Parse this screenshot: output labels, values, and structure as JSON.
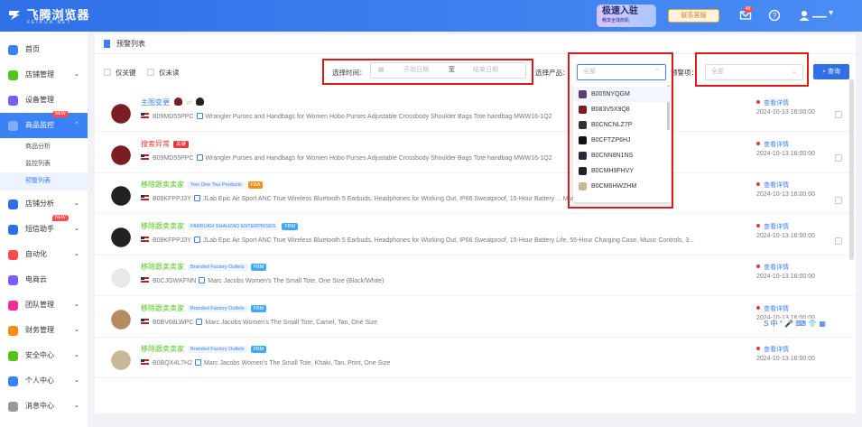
{
  "app": {
    "name": "飞腾浏览器",
    "subtitle": "FEIKUA.NET"
  },
  "header": {
    "promo_title": "极速入驻",
    "promo_sub": "畅享全球商机",
    "customer_service": "联系客服",
    "notification_count": "45",
    "user": "▁▁ ▾"
  },
  "sidebar": {
    "items": [
      {
        "label": "首页",
        "icon": "home-icon",
        "color": "#3b82f6"
      },
      {
        "label": "店铺管理",
        "icon": "store-icon",
        "color": "#52c41a",
        "chev": "⌄"
      },
      {
        "label": "设备管理",
        "icon": "device-icon",
        "color": "#7c5cff"
      },
      {
        "label": "商品监控",
        "icon": "monitor-icon",
        "color": "#ffffff",
        "chev": "⌃",
        "badge": "NEW"
      },
      {
        "label": "店铺分析",
        "icon": "analysis-icon",
        "color": "#2f6fe8",
        "chev": "⌄"
      },
      {
        "label": "短信助手",
        "icon": "sms-icon",
        "color": "#2f6fe8",
        "chev": "⌄",
        "badge": "NEW"
      },
      {
        "label": "自动化",
        "icon": "automation-icon",
        "color": "#ff4d4f",
        "chev": "⌄"
      },
      {
        "label": "电商云",
        "icon": "cloud-icon",
        "color": "#7c5cff"
      },
      {
        "label": "团队管理",
        "icon": "team-icon",
        "color": "#eb2f96",
        "chev": "⌄"
      },
      {
        "label": "财务管理",
        "icon": "finance-icon",
        "color": "#fa8c16",
        "chev": "⌄"
      },
      {
        "label": "安全中心",
        "icon": "security-icon",
        "color": "#52c41a",
        "chev": "⌄"
      },
      {
        "label": "个人中心",
        "icon": "user-icon",
        "color": "#3b82f6",
        "chev": "⌄"
      },
      {
        "label": "消息中心",
        "icon": "bell-icon",
        "color": "#999999",
        "chev": "⌄"
      }
    ],
    "sub_items": [
      "商品分析",
      "监控列表",
      "预警列表"
    ]
  },
  "page": {
    "title": "预警列表"
  },
  "filters": {
    "only_key": "仅关键",
    "only_unread": "仅未读",
    "time_label": "选择时间：",
    "start_placeholder": "开始日期",
    "range_sep": "至",
    "end_placeholder": "结束日期",
    "product_label": "选择产品：",
    "product_placeholder": "全部",
    "warn_label": "预警项：",
    "warn_placeholder": "全部",
    "query": "查询"
  },
  "dropdown": {
    "options": [
      "B005NYQGM",
      "B083V5X9Q8",
      "B0CNCNLZ7P",
      "B0CFTZP6HJ",
      "B0CNN8N1NS",
      "B0CMH9FHVY",
      "B0CM6HWZHM"
    ]
  },
  "rows": [
    {
      "title": "主图变更",
      "tclass": "blue",
      "tags": [],
      "asin": "B09MD55PPC",
      "desc": "Wrangler Purses and Handbags for Women Hobo Purses Adjustable Crossbody Shoulder Bags Tote handbag MWW16-1Q2",
      "time": "2024-10-13 16:00:00",
      "img": "#7a1e24"
    },
    {
      "title": "搜索异常",
      "tclass": "red",
      "tags": [
        {
          "t": "关键",
          "bg": "#e5383b",
          "c": "#fff"
        }
      ],
      "asin": "B09MD55PPC",
      "desc": "Wrangler Purses and Handbags for Women Hobo Purses Adjustable Crossbody Shoulder Bags Tote handbag MWW16-1Q2",
      "time": "2024-10-13 16:00:00",
      "img": "#7a1e24"
    },
    {
      "title": "移除跟卖卖家",
      "tclass": "green",
      "tags": [
        {
          "t": "Two One Two Products",
          "bg": "#eef4ff",
          "c": "#3b82f6"
        },
        {
          "t": "FBA",
          "bg": "#fa8c16",
          "c": "#fff"
        }
      ],
      "asin": "B08KFPPJ3Y",
      "desc": "JLab Epic Air Sport ANC True Wireless Bluetooth 5 Earbuds, Headphones for Working Out, IP66 Sweatproof, 15-Hour Battery ... Music Controls, 3...",
      "time": "2024-10-13 16:00:00",
      "img": "#222"
    },
    {
      "title": "移除跟卖卖家",
      "tclass": "green",
      "tags": [
        {
          "t": "FARRUKH SHAHZAD ENTERPRISES",
          "bg": "#eef4ff",
          "c": "#3b82f6"
        },
        {
          "t": "FBM",
          "bg": "#40a9ff",
          "c": "#fff"
        }
      ],
      "asin": "B08KFPPJ3Y",
      "desc": "JLab Epic Air Sport ANC True Wireless Bluetooth 5 Earbuds, Headphones for Working Out, IP66 Sweatproof, 15-Hour Battery Life, 55-Hour Charging Case, Music Controls, 3...",
      "time": "2024-10-13 16:00:00",
      "img": "#222"
    },
    {
      "title": "移除跟卖卖家",
      "tclass": "green",
      "tags": [
        {
          "t": "Branded Factory Outlets",
          "bg": "#eef4ff",
          "c": "#3b82f6"
        },
        {
          "t": "FBM",
          "bg": "#40a9ff",
          "c": "#fff"
        }
      ],
      "asin": "B0CJGWKFNN",
      "desc": "Marc Jacobs Women's The Small Tote, One Size (Black/White)",
      "time": "2024-10-13 16:00:00",
      "img": "#e8e8e8"
    },
    {
      "title": "移除跟卖卖家",
      "tclass": "green",
      "tags": [
        {
          "t": "Branded Factory Outlets",
          "bg": "#eef4ff",
          "c": "#3b82f6"
        },
        {
          "t": "FBM",
          "bg": "#40a9ff",
          "c": "#fff"
        }
      ],
      "asin": "B0BV68LWPC",
      "desc": "Marc Jacobs Women's The Small Tote, Camel, Tan, One Size",
      "time": "2024-10-13 16:00:00",
      "img": "#b48a5e"
    },
    {
      "title": "移除跟卖卖家",
      "tclass": "green",
      "tags": [
        {
          "t": "Branded Factory Outlets",
          "bg": "#eef4ff",
          "c": "#3b82f6"
        },
        {
          "t": "FBM",
          "bg": "#40a9ff",
          "c": "#fff"
        }
      ],
      "asin": "B0BQX4L7H2",
      "desc": "Marc Jacobs Women's The Small Tote, Khaki, Tan, Print, One Size",
      "time": "2024-10-13 16:00:00",
      "img": "#c8b89a"
    }
  ],
  "detail_label": "查看详情",
  "ime_toolbar": "S 中 ° 🎤 ⌨ 👕 ▦"
}
